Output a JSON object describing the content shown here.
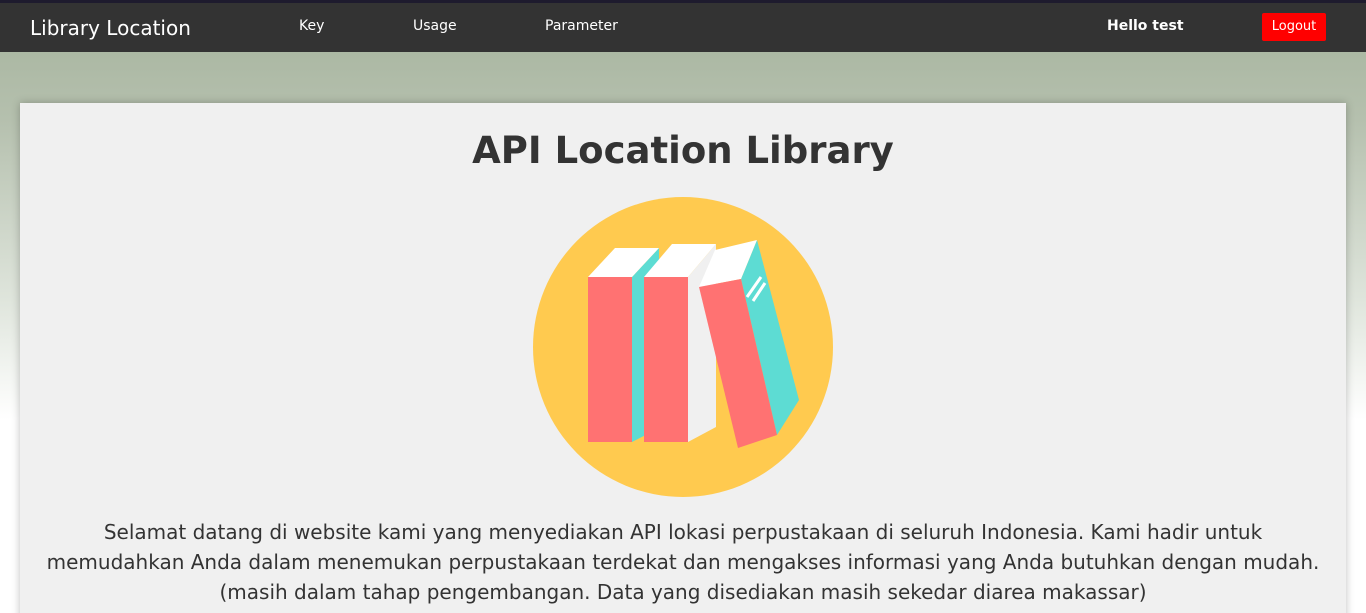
{
  "navbar": {
    "brand": "Library Location",
    "links": [
      {
        "label": "Key"
      },
      {
        "label": "Usage"
      },
      {
        "label": "Parameter"
      }
    ],
    "greeting": "Hello test",
    "logout_label": "Logout"
  },
  "main": {
    "title": "API Location Library",
    "illustration_icon": "books-icon",
    "description_line1": "Selamat datang di website kami yang menyediakan API lokasi perpustakaan di seluruh Indonesia. Kami hadir untuk",
    "description_line2": "memudahkan Anda dalam menemukan perpustakaan terdekat dan mengakses informasi yang Anda butuhkan dengan mudah.",
    "description_line3": "(masih dalam tahap pengembangan. Data yang disediakan masih sekedar diarea makassar)"
  },
  "colors": {
    "navbar_bg": "#333333",
    "logout_bg": "#ff0000",
    "circle": "#ffca4f",
    "book_red": "#ff7272",
    "book_teal": "#5ddcd3"
  }
}
